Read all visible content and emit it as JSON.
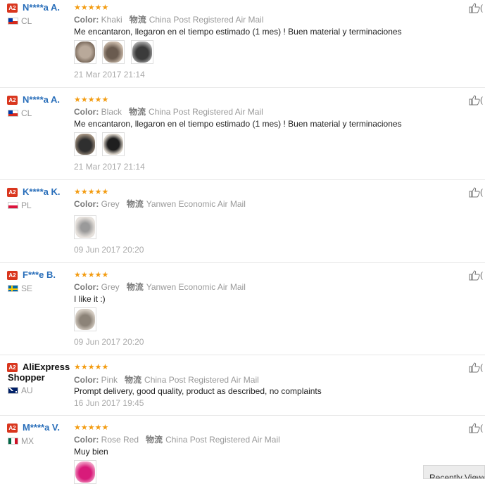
{
  "badge": "A2",
  "reviews": [
    {
      "name": "N****a A.",
      "country": "CL",
      "color_label": "Color:",
      "color": "Khaki",
      "logistics_label": "物流",
      "shipping": "China Post Registered Air Mail",
      "text": "Me encantaron, llegaron en el tiempo estimado (1 mes) ! Buen material y terminaciones",
      "date": "21 Mar 2017 21:14",
      "photos": 3,
      "like": "("
    },
    {
      "name": "N****a A.",
      "country": "CL",
      "color_label": "Color:",
      "color": "Black",
      "logistics_label": "物流",
      "shipping": "China Post Registered Air Mail",
      "text": "Me encantaron, llegaron en el tiempo estimado (1 mes) ! Buen material y terminaciones",
      "date": "21 Mar 2017 21:14",
      "photos": 2,
      "like": "("
    },
    {
      "name": "K****a K.",
      "country": "PL",
      "color_label": "Color:",
      "color": "Grey",
      "logistics_label": "物流",
      "shipping": "Yanwen Economic Air Mail",
      "text": "",
      "date": "09 Jun 2017 20:20",
      "photos": 1,
      "like": "("
    },
    {
      "name": "F***e B.",
      "country": "SE",
      "color_label": "Color:",
      "color": "Grey",
      "logistics_label": "物流",
      "shipping": "Yanwen Economic Air Mail",
      "text": "I like it :)",
      "date": "09 Jun 2017 20:20",
      "photos": 1,
      "like": "("
    },
    {
      "name": "AliExpress",
      "name_line2": "Shopper",
      "country": "AU",
      "color_label": "Color:",
      "color": "Pink",
      "logistics_label": "物流",
      "shipping": "China Post Registered Air Mail",
      "text": "Prompt delivery, good quality, product as described, no complaints",
      "date": "16 Jun 2017 19:45",
      "photos": 0,
      "like": "("
    },
    {
      "name": "M****a V.",
      "country": "MX",
      "color_label": "Color:",
      "color": "Rose Red",
      "logistics_label": "物流",
      "shipping": "China Post Registered Air Mail",
      "text": "Muy bien",
      "date": "",
      "photos": 1,
      "like": "("
    }
  ],
  "rating_stars": "★★★★★",
  "recently_viewed": "Recently Viewed",
  "colors": {
    "star": "#f39c12",
    "name": "#2a6fba",
    "badge": "#d9361e"
  }
}
